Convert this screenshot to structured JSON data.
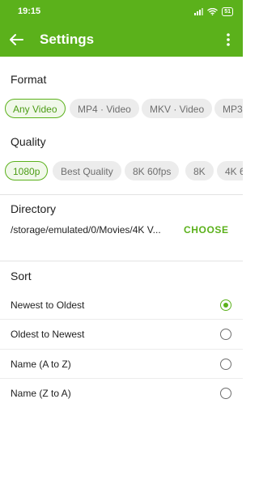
{
  "status_bar": {
    "time": "19:15",
    "battery": "51"
  },
  "app_bar": {
    "title": "Settings"
  },
  "format": {
    "title": "Format",
    "chips": [
      "Any Video",
      "MP4 · Video",
      "MKV · Video",
      "MP3"
    ],
    "selected": "Any Video"
  },
  "quality": {
    "title": "Quality",
    "chips": [
      "1080p",
      "Best Quality",
      "8K 60fps",
      "8K",
      "4K 6"
    ],
    "selected": "1080p"
  },
  "directory": {
    "title": "Directory",
    "path": "/storage/emulated/0/Movies/4K V...",
    "choose_label": "CHOOSE"
  },
  "sort": {
    "title": "Sort",
    "options": [
      "Newest to Oldest",
      "Oldest to Newest",
      "Name (A to Z)",
      "Name (Z to A)"
    ],
    "selected": "Newest to Oldest"
  },
  "colors": {
    "accent": "#5bb11b"
  }
}
